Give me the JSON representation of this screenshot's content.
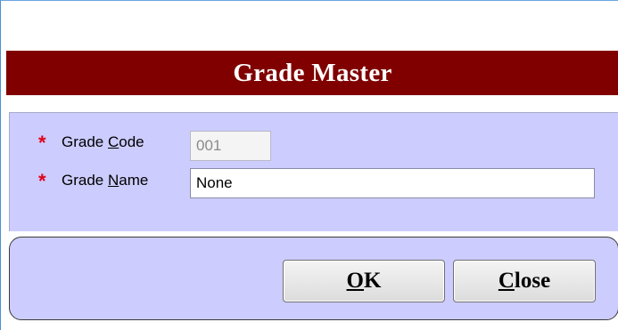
{
  "dialog": {
    "title": "Grade Master"
  },
  "form": {
    "grade_code": {
      "required_marker": "*",
      "label_before": "Grade ",
      "label_mnemonic": "C",
      "label_after": "ode",
      "value": "001"
    },
    "grade_name": {
      "required_marker": "*",
      "label_before": "Grade ",
      "label_mnemonic": "N",
      "label_after": "ame",
      "value": "None"
    }
  },
  "buttons": {
    "ok": {
      "mnemonic": "O",
      "rest": "K"
    },
    "close": {
      "mnemonic": "C",
      "rest": "lose"
    }
  },
  "colors": {
    "title_bar": "#800000",
    "panel": "#ccccff",
    "required_star": "#e0001a"
  }
}
